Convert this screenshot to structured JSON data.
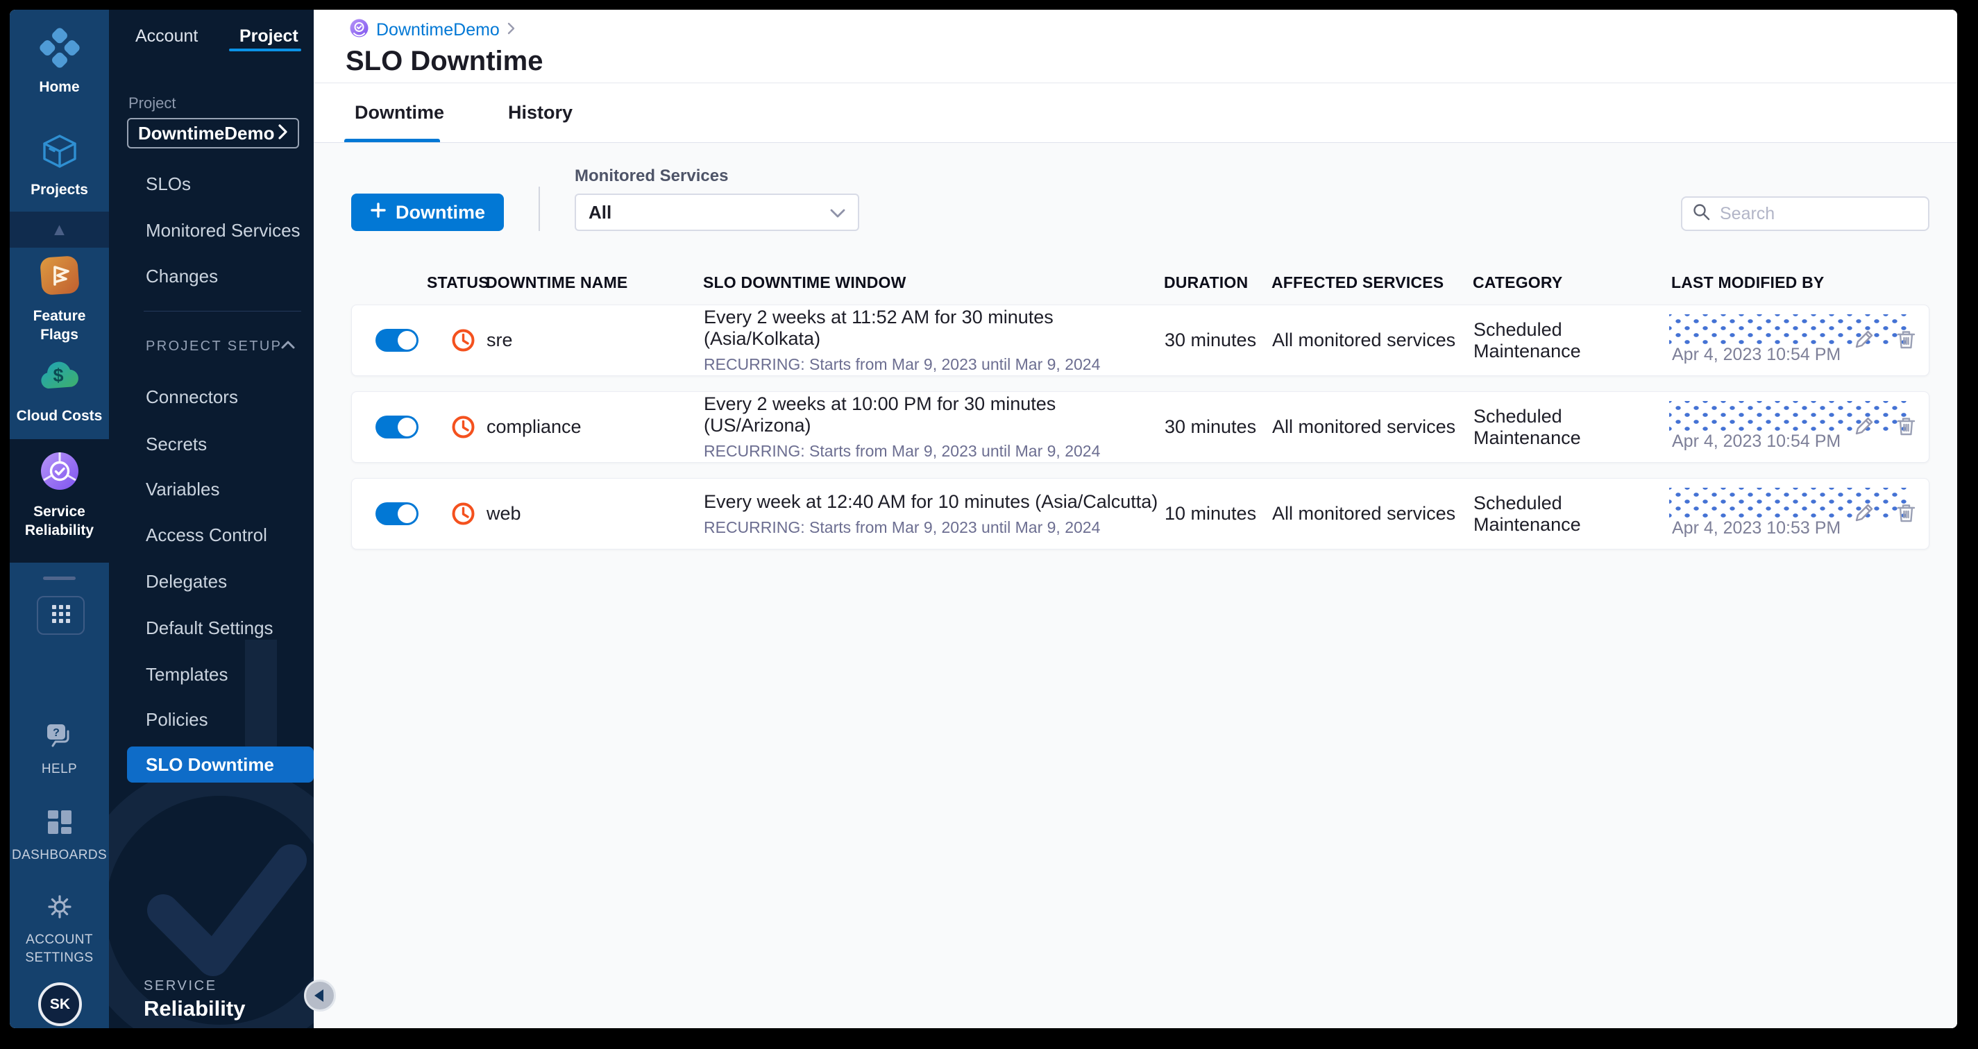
{
  "modulebar": {
    "items": [
      {
        "label": "Home",
        "icon": "home-icon"
      },
      {
        "label": "Projects",
        "icon": "projects-icon"
      },
      {
        "label": "Feature Flags",
        "icon": "feature-flags-icon"
      },
      {
        "label": "Cloud Costs",
        "icon": "cloud-costs-icon"
      },
      {
        "label": "Service Reliability",
        "icon": "service-reliability-icon",
        "active": true
      }
    ],
    "footer_items": [
      {
        "label": "HELP",
        "icon": "help-icon"
      },
      {
        "label": "DASHBOARDS",
        "icon": "dashboards-icon"
      },
      {
        "label": "ACCOUNT SETTINGS",
        "icon": "gear-icon"
      }
    ],
    "avatar_initials": "SK"
  },
  "sidebar": {
    "tabs": [
      {
        "label": "Account"
      },
      {
        "label": "Project",
        "active": true
      }
    ],
    "project_field_label": "Project",
    "project_name": "DowntimeDemo",
    "nav_items": [
      "SLOs",
      "Monitored Services",
      "Changes"
    ],
    "setup_heading": "PROJECT SETUP",
    "setup_items": [
      "Connectors",
      "Secrets",
      "Variables",
      "Access Control",
      "Delegates",
      "Default Settings",
      "Templates",
      "Policies",
      "SLO Downtime"
    ],
    "active_item": "SLO Downtime",
    "footer_kicker": "SERVICE",
    "footer_title": "Reliability"
  },
  "header": {
    "breadcrumb": "DowntimeDemo",
    "title": "SLO Downtime"
  },
  "tabs": [
    {
      "label": "Downtime",
      "active": true
    },
    {
      "label": "History"
    }
  ],
  "toolbar": {
    "new_label": "Downtime",
    "filter_label": "Monitored Services",
    "filter_value": "All",
    "search_placeholder": "Search"
  },
  "table": {
    "columns": [
      "STATUS",
      "DOWNTIME NAME",
      "SLO DOWNTIME WINDOW",
      "DURATION",
      "AFFECTED SERVICES",
      "CATEGORY",
      "LAST MODIFIED BY"
    ],
    "rows": [
      {
        "enabled": true,
        "name": "sre",
        "window": "Every 2 weeks at 11:52 AM for 30 minutes (Asia/Kolkata)",
        "recurrence": "RECURRING: Starts from Mar 9, 2023 until Mar 9, 2024",
        "duration": "30 minutes",
        "affected": "All monitored services",
        "category": "Scheduled Maintenance",
        "modified": "Apr 4, 2023 10:54 PM"
      },
      {
        "enabled": true,
        "name": "compliance",
        "window": "Every 2 weeks at 10:00 PM for 30 minutes (US/Arizona)",
        "recurrence": "RECURRING: Starts from Mar 9, 2023 until Mar 9, 2024",
        "duration": "30 minutes",
        "affected": "All monitored services",
        "category": "Scheduled Maintenance",
        "modified": "Apr 4, 2023 10:54 PM"
      },
      {
        "enabled": true,
        "name": "web",
        "window": "Every week at 12:40 AM for 10 minutes (Asia/Calcutta)",
        "recurrence": "RECURRING: Starts from Mar 9, 2023 until Mar 9, 2024",
        "duration": "10 minutes",
        "affected": "All monitored services",
        "category": "Scheduled Maintenance",
        "modified": "Apr 4, 2023 10:53 PM"
      }
    ]
  },
  "colors": {
    "primary": "#0278d5",
    "sidebar_tab_underline": "#0b92e6",
    "active_nav_bg": "#0e6cc8",
    "clock_icon": "#f4511e",
    "redaction_dot": "#4472d4",
    "module_bar_blue": "#15416d",
    "panel_dark": "#0a1b30"
  }
}
